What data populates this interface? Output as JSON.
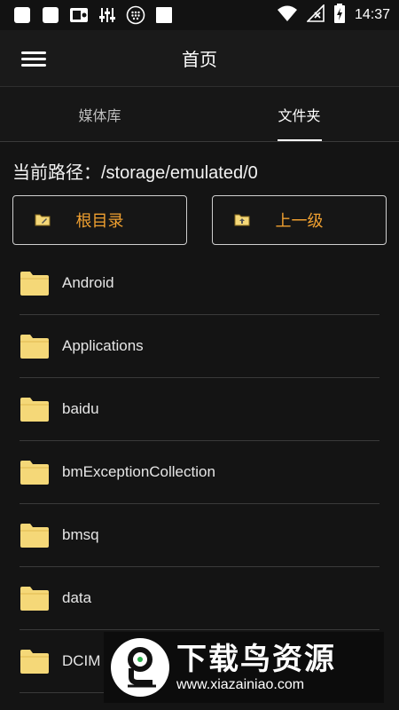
{
  "status_bar": {
    "time": "14:37",
    "left_icons": [
      "app-square-icon",
      "app-square-icon",
      "radio-icon",
      "equalizer-icon",
      "dots-grid-icon",
      "app-square-icon"
    ],
    "right_icons": [
      "wifi-icon",
      "signal-off-icon",
      "battery-charging-icon"
    ]
  },
  "app_bar": {
    "title": "首页"
  },
  "tabs": [
    {
      "label": "媒体库",
      "active": false
    },
    {
      "label": "文件夹",
      "active": true
    }
  ],
  "path": {
    "label": "当前路径：",
    "value": "/storage/emulated/0"
  },
  "buttons": {
    "root_label": "根目录",
    "up_label": "上一级"
  },
  "files": [
    {
      "name": "Android"
    },
    {
      "name": "Applications"
    },
    {
      "name": "baidu"
    },
    {
      "name": "bmExceptionCollection"
    },
    {
      "name": "bmsq"
    },
    {
      "name": "data"
    },
    {
      "name": "DCIM"
    }
  ],
  "watermark": {
    "title": "下载鸟资源",
    "url": "www.xiazainiao.com"
  },
  "colors": {
    "accent": "#f0a030",
    "folder": "#f5d878",
    "background": "#141414"
  }
}
